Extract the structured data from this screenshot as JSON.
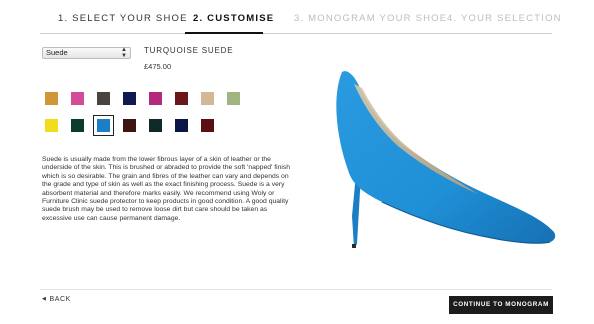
{
  "steps": [
    {
      "label": "1. SELECT YOUR SHOE"
    },
    {
      "label": "2. CUSTOMISE"
    },
    {
      "label": "3. MONOGRAM YOUR SHOE"
    },
    {
      "label": "4. YOUR SELECTION"
    }
  ],
  "active_step": 2,
  "material": {
    "selected": "Suede"
  },
  "product": {
    "name": "TURQUOISE SUEDE",
    "price": "£475.00"
  },
  "swatches": {
    "row1": [
      "#d1953a",
      "#d34c9c",
      "#4a4440",
      "#101a52",
      "#b22a7c",
      "#6b1618",
      "#d3b796",
      "#9fb47f"
    ],
    "row2": [
      "#f1dd1b",
      "#0c3b2f",
      "#1a7fc6",
      "#3e1410",
      "#0e2a26",
      "#0d1546",
      "#5c0f12"
    ],
    "selected": "#1a7fc6"
  },
  "description": "Suede is usually made from the lower fibrous layer of a skin of leather or the underside of the skin. This is brushed or abraded to provide the soft 'napped' finish which is so desirable. The grain and fibres of the leather can vary and depends on the grade and type of skin as well as the exact finishing process. Suede is a very absorbent material and therefore marks easily. We recommend using Woly or Furniture Clinic suede protector to keep products in good condition. A good quality suede brush may be used to remove loose dirt but care should be taken as excessive use can cause permanent damage.",
  "footer": {
    "back": "BACK",
    "continue": "CONTINUE TO MONOGRAM"
  },
  "colors": {
    "shoe": "#1f8fd6",
    "dark": "#1c1c1c"
  }
}
